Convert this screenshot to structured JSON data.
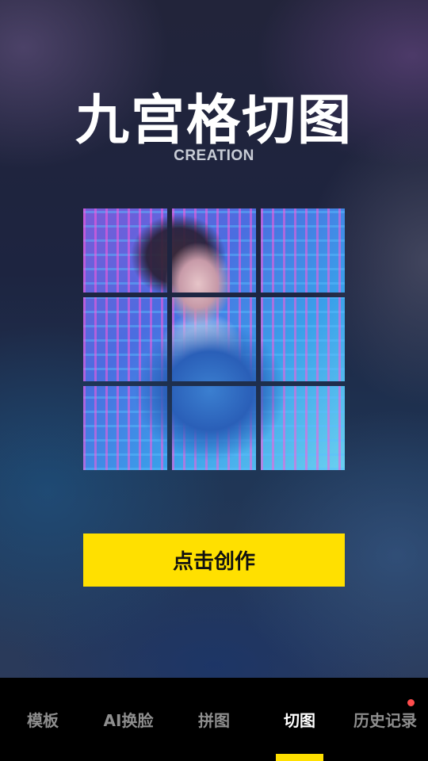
{
  "header": {
    "title": "九宫格切图",
    "subtitle": "CREATION"
  },
  "main": {
    "grid": {
      "rows": 3,
      "columns": 3,
      "cells": 9
    },
    "action_button_label": "点击创作"
  },
  "tabbar": {
    "tabs": [
      {
        "label": "模板",
        "active": false
      },
      {
        "label": "AI换脸",
        "active": false
      },
      {
        "label": "拼图",
        "active": false
      },
      {
        "label": "切图",
        "active": true
      },
      {
        "label": "历史记录",
        "active": false,
        "badge": true
      }
    ]
  },
  "colors": {
    "accent": "#ffe000",
    "tab_inactive": "#8e8e8e",
    "tab_active": "#ffffff",
    "badge": "#ff4d4d",
    "tabbar_background": "#000000"
  }
}
